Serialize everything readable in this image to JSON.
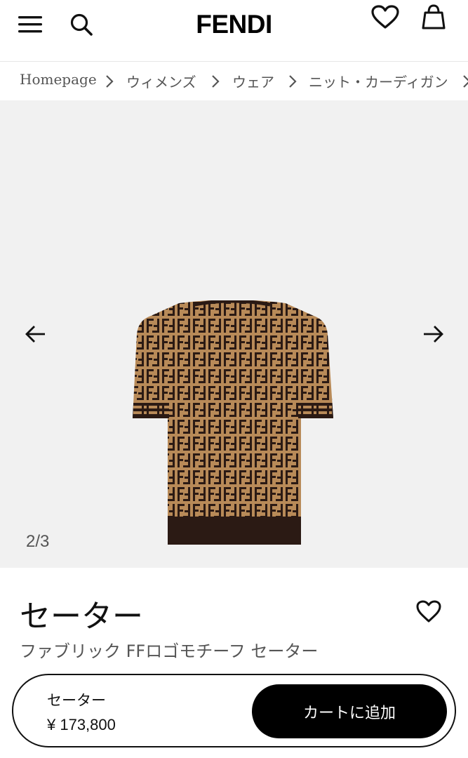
{
  "header": {
    "logo": "FENDI",
    "icons": [
      "menu-icon",
      "search-icon",
      "heart-icon",
      "shopping-bag-icon"
    ]
  },
  "breadcrumb": {
    "items": [
      "Homepage",
      "ウィメンズ",
      "ウェア",
      "ニット・カーディガン"
    ]
  },
  "gallery": {
    "counter": "2/3",
    "background": "#f1f1f1",
    "product_colors": {
      "tan": "#b88a58",
      "brown": "#2b1a14"
    }
  },
  "product": {
    "title": "セーター",
    "subtitle": "ファブリック FFロゴモチーフ セーター"
  },
  "sticky_bar": {
    "name": "セーター",
    "price": "¥ 173,800",
    "cart_button": "カートに追加"
  }
}
